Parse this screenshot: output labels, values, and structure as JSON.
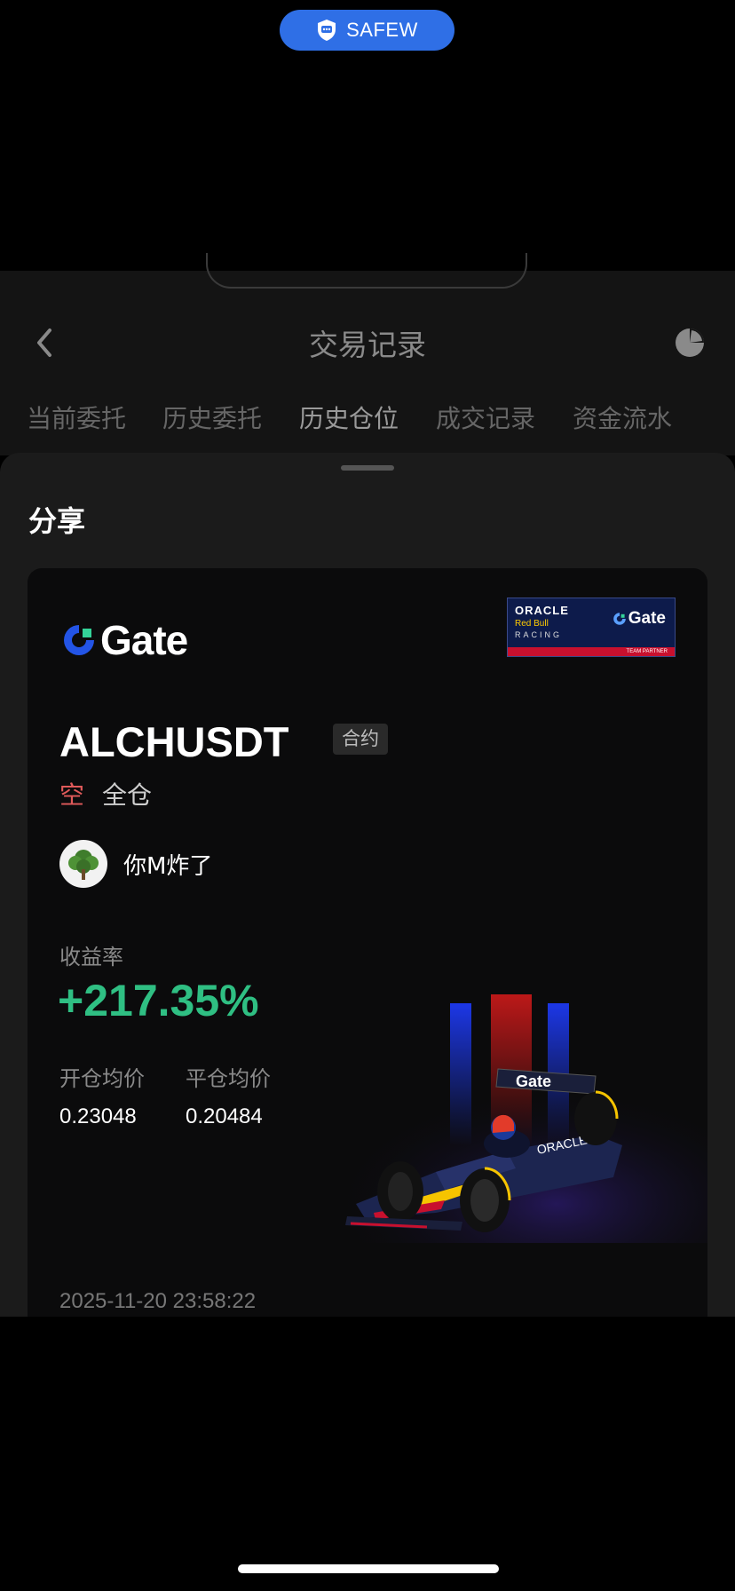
{
  "status_pill": {
    "label": "SAFEW",
    "color": "#2f6fe6"
  },
  "header": {
    "title": "交易记录"
  },
  "tabs": [
    {
      "label": "当前委托"
    },
    {
      "label": "历史委托"
    },
    {
      "label": "历史仓位"
    },
    {
      "label": "成交记录"
    },
    {
      "label": "资金流水"
    }
  ],
  "sheet": {
    "title": "分享"
  },
  "card": {
    "brand": "Gate",
    "partner": {
      "line1": "ORACLE",
      "line2": "Red Bull",
      "line3": "RACING",
      "gate": "Gate",
      "footer": "TEAM PARTNER"
    },
    "symbol": "ALCHUSDT",
    "tag": "合约",
    "side": "空",
    "margin_mode": "全仓",
    "username": "你M炸了",
    "roi_label": "收益率",
    "roi_value": "+217.35%",
    "open_price_label": "开仓均价",
    "open_price": "0.23048",
    "close_price_label": "平仓均价",
    "close_price": "0.20484",
    "timestamp": "2025-11-20 23:58:22"
  },
  "colors": {
    "profit": "#2fbf83",
    "short": "#e05a5a",
    "brand_blue": "#2354e6"
  }
}
